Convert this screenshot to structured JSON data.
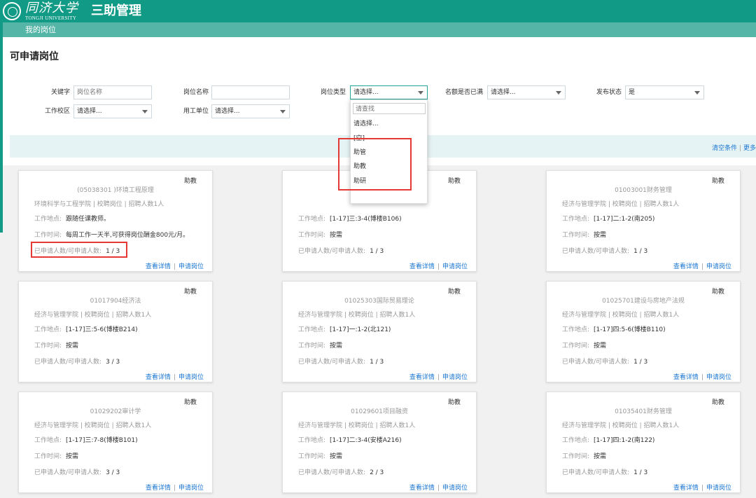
{
  "header": {
    "logo_cn": "同济大学",
    "logo_en": "TONGJI UNIVERSITY",
    "app_title": "三助管理",
    "nav_item": "我的岗位"
  },
  "page": {
    "title": "可申请岗位"
  },
  "filters": {
    "keyword_label": "关键字",
    "keyword_placeholder": "岗位名称",
    "post_name_label": "岗位名称",
    "post_name_value": "",
    "post_type_label": "岗位类型",
    "post_type_value": "请选择...",
    "quota_label": "名额是否已满",
    "quota_value": "请选择...",
    "publish_label": "发布状态",
    "publish_value": "是",
    "campus_label": "工作校区",
    "campus_value": "请选择...",
    "employer_label": "用工单位",
    "employer_value": "请选择..."
  },
  "filter_bar": {
    "clear": "清空条件",
    "sep": "|",
    "more": "更多"
  },
  "dropdown": {
    "search_placeholder": "请查找",
    "options": [
      "请选择...",
      "[空]",
      "助管",
      "助教",
      "助研"
    ]
  },
  "card_labels": {
    "location": "工作地点:",
    "time": "工作时间:",
    "count": "已申请人数/可申请人数:",
    "detail": "查看详情",
    "apply": "申请岗位",
    "sep": "|"
  },
  "cards": [
    {
      "badge": "助教",
      "title": "(05038301 )环境工程原理",
      "meta": "环境科学与工程学院 | 校聘岗位 | 招聘人数1人",
      "location": "跟随任课教师。",
      "time": "每周工作一天半,可获得岗位酬金800元/月。",
      "count": "1 / 3"
    },
    {
      "badge": "助教",
      "title": "",
      "meta": "",
      "location": "[1-17]三:3-4(博楼B106)",
      "time": "按需",
      "count": "1 / 3"
    },
    {
      "badge": "助教",
      "title": "01003001财务管理",
      "meta": "经济与管理学院 | 校聘岗位 | 招聘人数1人",
      "location": "[1-17]二:1-2(南205)",
      "time": "按需",
      "count": "1 / 3"
    },
    {
      "badge": "助教",
      "title": "01017904经济法",
      "meta": "经济与管理学院 | 校聘岗位 | 招聘人数1人",
      "location": "[1-17]三:5-6(博楼B214)",
      "time": "按需",
      "count": "3 / 3"
    },
    {
      "badge": "助教",
      "title": "01025303国际贸易理论",
      "meta": "经济与管理学院 | 校聘岗位 | 招聘人数1人",
      "location": "[1-17]一:1-2(北121)",
      "time": "按需",
      "count": "1 / 3"
    },
    {
      "badge": "助教",
      "title": "01025701建设与房地产法规",
      "meta": "经济与管理学院 | 校聘岗位 | 招聘人数1人",
      "location": "[1-17]四:5-6(博楼B110)",
      "time": "按需",
      "count": "1 / 3"
    },
    {
      "badge": "助教",
      "title": "01029202审计学",
      "meta": "经济与管理学院 | 校聘岗位 | 招聘人数1人",
      "location": "[1-17]三:7-8(博楼B101)",
      "time": "按需",
      "count": "3 / 3"
    },
    {
      "badge": "助教",
      "title": "01029601项目融资",
      "meta": "经济与管理学院 | 校聘岗位 | 招聘人数1人",
      "location": "[1-17]二:3-4(安楼A216)",
      "time": "按需",
      "count": "2 / 3"
    },
    {
      "badge": "助教",
      "title": "01035401财务管理",
      "meta": "经济与管理学院 | 校聘岗位 | 招聘人数1人",
      "location": "[1-17]四:1-2(南122)",
      "time": "按需",
      "count": "1 / 3"
    }
  ],
  "colors": {
    "header": "#119a85",
    "nav": "#55b5a6",
    "link": "#1976d2",
    "highlight": "#e53935"
  }
}
